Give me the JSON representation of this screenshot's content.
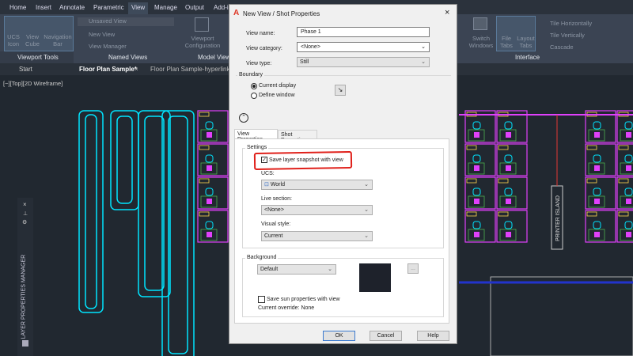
{
  "ribbon_tabs": [
    "Home",
    "Insert",
    "Annotate",
    "Parametric",
    "View",
    "Manage",
    "Output",
    "Add-i"
  ],
  "active_tab": "View",
  "viewport_tools": {
    "ucs": "UCS Icon",
    "view_cube": "View Cube",
    "nav_bar": "Navigation Bar",
    "title": "Viewport Tools"
  },
  "named_views": {
    "current": "Unsaved View",
    "new_view": "New View",
    "view_manager": "View Manager",
    "title": "Named Views"
  },
  "model_viewports": {
    "config": "Viewport Configuration",
    "title": "Model View"
  },
  "interface": {
    "switch_windows": "Switch Windows",
    "file_tabs": "File Tabs",
    "layout_tabs": "Layout Tabs",
    "tile_h": "Tile Horizontally",
    "tile_v": "Tile Vertically",
    "cascade": "Cascade",
    "title": "Interface"
  },
  "file_tabs": [
    "Start",
    "Floor Plan Sample*",
    "Floor Plan Sample-hyperlinks*"
  ],
  "viewport_label": "[−][Top][2D Wireframe]",
  "side_palette": {
    "title": "LAYER PROPERTIES MANAGER"
  },
  "drawing": {
    "printer_label": "PRINTER ISLAND",
    "colors": {
      "walls": "#00e5ff",
      "partitions": "#e040fb",
      "furniture": "#4caf50",
      "tags": "#ffd54f"
    }
  },
  "dialog": {
    "title": "New View / Shot Properties",
    "view_name_label": "View name:",
    "view_name": "Phase 1",
    "view_category_label": "View category:",
    "view_category": "<None>",
    "view_type_label": "View type:",
    "view_type": "Still",
    "boundary_title": "Boundary",
    "current_display": "Current display",
    "define_window": "Define window",
    "tabs": [
      "View Properties",
      "Shot Properties"
    ],
    "settings_title": "Settings",
    "save_layer_snapshot": "Save layer snapshot with view",
    "save_layer_snapshot_checked": true,
    "ucs_label": "UCS:",
    "ucs": "World",
    "live_section_label": "Live section:",
    "live_section": "<None>",
    "visual_style_label": "Visual style:",
    "visual_style": "Current",
    "background_title": "Background",
    "background": "Default",
    "background_color": "#1e222b",
    "save_sun": "Save sun properties with view",
    "save_sun_checked": false,
    "current_override": "Current override: None",
    "browse": "...",
    "ok": "OK",
    "cancel": "Cancel",
    "help": "Help",
    "annotation_color": "#e0201a"
  }
}
